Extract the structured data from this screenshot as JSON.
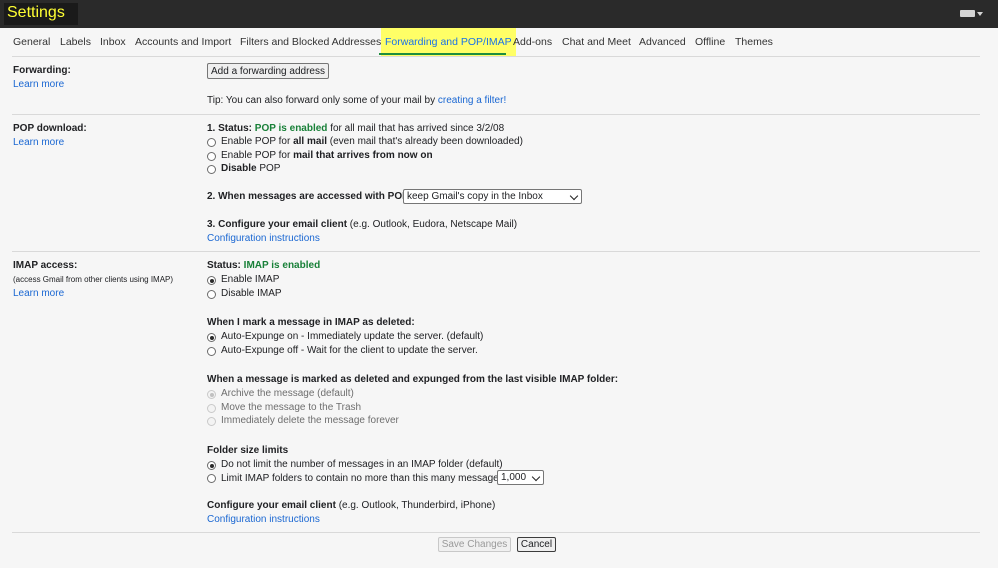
{
  "header": {
    "title": "Settings",
    "input_icon": "keyboard-icon"
  },
  "tabs": [
    {
      "label": "General"
    },
    {
      "label": "Labels"
    },
    {
      "label": "Inbox"
    },
    {
      "label": "Accounts and Import"
    },
    {
      "label": "Filters and Blocked Addresses"
    },
    {
      "label": "Forwarding and POP/IMAP"
    },
    {
      "label": "Add-ons"
    },
    {
      "label": "Chat and Meet"
    },
    {
      "label": "Advanced"
    },
    {
      "label": "Offline"
    },
    {
      "label": "Themes"
    }
  ],
  "active_tab": "Forwarding and POP/IMAP",
  "forwarding": {
    "label": "Forwarding:",
    "learn_more": "Learn more",
    "add_button": "Add a forwarding address",
    "tip_prefix": "Tip: You can also forward only some of your mail by ",
    "tip_link": "creating a filter!"
  },
  "pop": {
    "label": "POP download:",
    "learn_more": "Learn more",
    "status_prefix": "1. Status: ",
    "status_value": "POP is enabled",
    "status_suffix": " for all mail that has arrived since 3/2/08",
    "opt1_a": "Enable POP for ",
    "opt1_b": "all mail",
    "opt1_c": " (even mail that's already been downloaded)",
    "opt2_a": "Enable POP for ",
    "opt2_b": "mail that arrives from now on",
    "opt3_a": "Disable",
    "opt3_b": " POP",
    "q2_label": "2. When messages are accessed with POP",
    "q2_select": "keep Gmail's copy in the Inbox",
    "q3_label": "3. Configure your email client",
    "q3_hint": " (e.g. Outlook, Eudora, Netscape Mail)",
    "config_link": "Configuration instructions"
  },
  "imap": {
    "label": "IMAP access:",
    "sublabel": "(access Gmail from other clients using IMAP)",
    "learn_more": "Learn more",
    "status_prefix": "Status: ",
    "status_value": "IMAP is enabled",
    "enable": "Enable IMAP",
    "disable": "Disable IMAP",
    "deleted_heading": "When I mark a message in IMAP as deleted:",
    "auto_on": "Auto-Expunge on - Immediately update the server. (default)",
    "auto_off": "Auto-Expunge off - Wait for the client to update the server.",
    "expunged_heading": "When a message is marked as deleted and expunged from the last visible IMAP folder:",
    "archive": "Archive the message (default)",
    "trash": "Move the message to the Trash",
    "delete_forever": "Immediately delete the message forever",
    "folder_heading": "Folder size limits",
    "no_limit": "Do not limit the number of messages in an IMAP folder (default)",
    "limit": "Limit IMAP folders to contain no more than this many messages",
    "limit_select": "1,000",
    "client_label": "Configure your email client",
    "client_hint": " (e.g. Outlook, Thunderbird, iPhone)",
    "config_link": "Configuration instructions"
  },
  "footer": {
    "save": "Save Changes",
    "cancel": "Cancel"
  }
}
